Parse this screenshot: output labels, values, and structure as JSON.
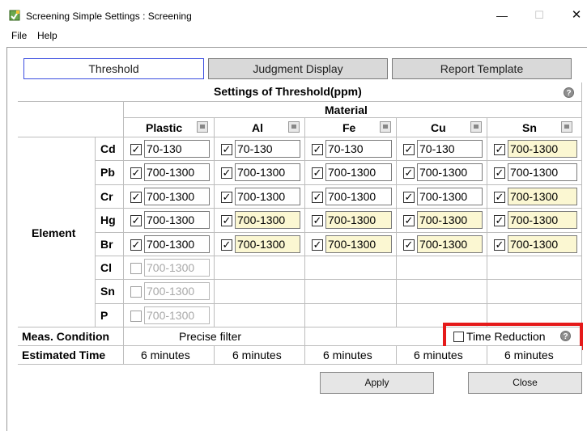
{
  "window": {
    "title": "Screening Simple Settings : Screening",
    "minimize_glyph": "—",
    "maximize_glyph": "☐",
    "close_glyph": "✕"
  },
  "menu": {
    "items": [
      "File",
      "Help"
    ]
  },
  "tabs": [
    {
      "label": "Threshold",
      "active": true
    },
    {
      "label": "Judgment Display",
      "active": false
    },
    {
      "label": "Report Template",
      "active": false
    }
  ],
  "table": {
    "title": "Settings of Threshold(ppm)",
    "help_glyph": "?",
    "group_label": "Material",
    "materials": [
      "Plastic",
      "Al",
      "Fe",
      "Cu",
      "Sn"
    ],
    "element_group_label": "Element",
    "elements": [
      "Cd",
      "Pb",
      "Cr",
      "Hg",
      "Br",
      "Cl",
      "Sn",
      "P"
    ],
    "check_glyph": "✓",
    "rows": [
      {
        "cells": [
          {
            "checked": true,
            "value": "70-130",
            "highlight": false
          },
          {
            "checked": true,
            "value": "70-130",
            "highlight": false
          },
          {
            "checked": true,
            "value": "70-130",
            "highlight": false
          },
          {
            "checked": true,
            "value": "70-130",
            "highlight": false
          },
          {
            "checked": true,
            "value": "700-1300",
            "highlight": true
          }
        ]
      },
      {
        "cells": [
          {
            "checked": true,
            "value": "700-1300",
            "highlight": false
          },
          {
            "checked": true,
            "value": "700-1300",
            "highlight": false
          },
          {
            "checked": true,
            "value": "700-1300",
            "highlight": false
          },
          {
            "checked": true,
            "value": "700-1300",
            "highlight": false
          },
          {
            "checked": true,
            "value": "700-1300",
            "highlight": false
          }
        ]
      },
      {
        "cells": [
          {
            "checked": true,
            "value": "700-1300",
            "highlight": false
          },
          {
            "checked": true,
            "value": "700-1300",
            "highlight": false
          },
          {
            "checked": true,
            "value": "700-1300",
            "highlight": false
          },
          {
            "checked": true,
            "value": "700-1300",
            "highlight": false
          },
          {
            "checked": true,
            "value": "700-1300",
            "highlight": true
          }
        ]
      },
      {
        "cells": [
          {
            "checked": true,
            "value": "700-1300",
            "highlight": false
          },
          {
            "checked": true,
            "value": "700-1300",
            "highlight": true
          },
          {
            "checked": true,
            "value": "700-1300",
            "highlight": true
          },
          {
            "checked": true,
            "value": "700-1300",
            "highlight": true
          },
          {
            "checked": true,
            "value": "700-1300",
            "highlight": true
          }
        ]
      },
      {
        "cells": [
          {
            "checked": true,
            "value": "700-1300",
            "highlight": false
          },
          {
            "checked": true,
            "value": "700-1300",
            "highlight": true
          },
          {
            "checked": true,
            "value": "700-1300",
            "highlight": true
          },
          {
            "checked": true,
            "value": "700-1300",
            "highlight": true
          },
          {
            "checked": true,
            "value": "700-1300",
            "highlight": true
          }
        ]
      },
      {
        "cells": [
          {
            "checked": false,
            "value": "700-1300",
            "highlight": false
          }
        ]
      },
      {
        "cells": [
          {
            "checked": false,
            "value": "700-1300",
            "highlight": false
          }
        ]
      },
      {
        "cells": [
          {
            "checked": false,
            "value": "700-1300",
            "highlight": false
          }
        ]
      }
    ],
    "meas_condition": {
      "label": "Meas. Condition",
      "value": "Precise filter",
      "time_reduction_label": "Time Reduction",
      "time_reduction_checked": false
    },
    "estimated_time": {
      "label": "Estimated Time",
      "values": [
        "6 minutes",
        "6 minutes",
        "6 minutes",
        "6 minutes",
        "6 minutes"
      ]
    }
  },
  "buttons": {
    "apply": "Apply",
    "close": "Close"
  },
  "colors": {
    "highlight_cell": "#fbf7d2",
    "callout_border": "#e51a1a",
    "active_tab_border": "#3c4ee0"
  }
}
